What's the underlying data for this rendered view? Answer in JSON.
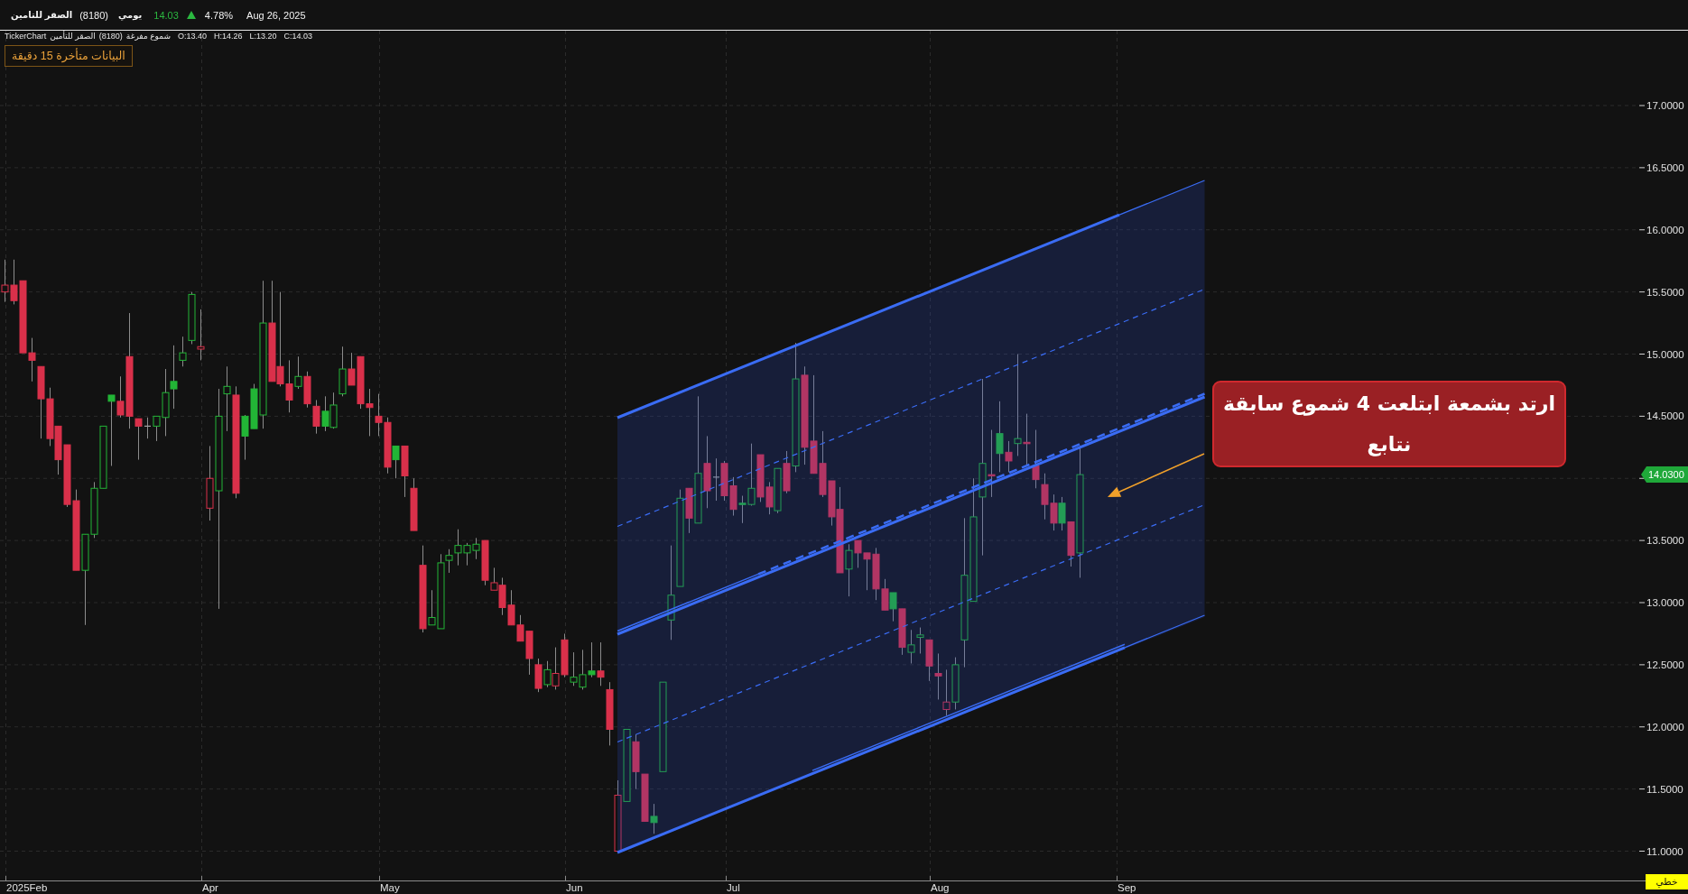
{
  "header": {
    "company": "الصقر للتامين",
    "symbol": "(8180)",
    "period": "يومي",
    "price": "14.03",
    "rising": true,
    "change": "4.78%",
    "date": "Aug 26, 2025"
  },
  "chart": {
    "legend": {
      "source": "TickerChart",
      "name": "الصقر للتأمين",
      "symbol": "(8180)",
      "chart_type": "شموع مفرغة",
      "ohlc": [
        "O:13.40",
        "H:14.26",
        "L:13.20",
        "C:14.03"
      ]
    },
    "delay_notice": "البيانات متأخرة 15 دقيقة",
    "annotation": "ارتد بشمعة ابتلعت 4 شموع سابقة\nنتابع",
    "price_axis": [
      "17.0000",
      "16.5000",
      "16.0000",
      "15.5000",
      "15.0000",
      "14.5000",
      "13.5000",
      "13.0000",
      "12.5000",
      "12.0000",
      "11.5000",
      "11.0000"
    ],
    "last_price": "14.0300",
    "time_axis": [
      "2025Feb",
      "Apr",
      "May",
      "Jun",
      "Jul",
      "Aug",
      "Sep"
    ],
    "scale_mode": "خطي"
  }
}
